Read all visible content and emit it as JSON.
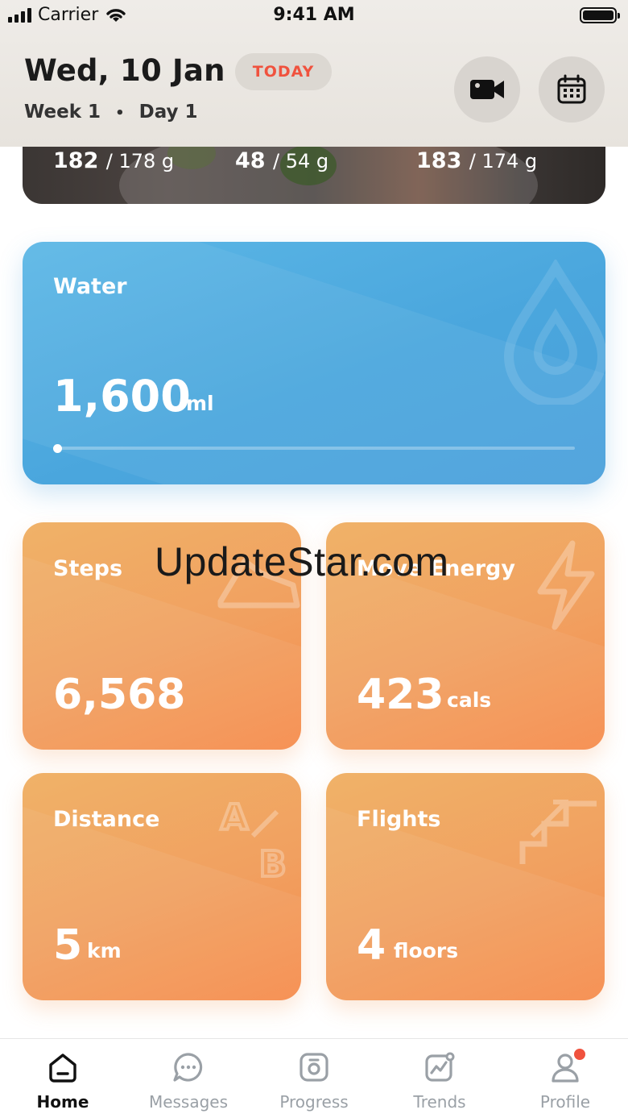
{
  "status_bar": {
    "carrier": "Carrier",
    "time": "9:41 AM"
  },
  "header": {
    "date": "Wed, 10 Jan",
    "badge": "TODAY",
    "week": "Week 1",
    "separator": "•",
    "day": "Day 1",
    "video_icon": "video-camera-icon",
    "calendar_icon": "calendar-icon"
  },
  "macros": [
    {
      "value": "182",
      "goal": "/ 178 g"
    },
    {
      "value": "48",
      "goal": "/ 54 g"
    },
    {
      "value": "183",
      "goal": "/ 174 g"
    }
  ],
  "water": {
    "label": "Water",
    "value": "1,600",
    "unit": "ml",
    "progress": 0.0
  },
  "tiles": {
    "steps": {
      "label": "Steps",
      "value": "6,568",
      "unit": ""
    },
    "move_energy": {
      "label": "Move Energy",
      "value": "423",
      "unit": "cals"
    },
    "distance": {
      "label": "Distance",
      "value": "5",
      "unit": "km"
    },
    "flights": {
      "label": "Flights",
      "value": "4",
      "unit": "floors"
    }
  },
  "watermark": "UpdateStar.com",
  "tabbar": {
    "items": [
      {
        "label": "Home",
        "icon": "home-icon",
        "active": true
      },
      {
        "label": "Messages",
        "icon": "chat-bubble-icon",
        "active": false
      },
      {
        "label": "Progress",
        "icon": "camera-icon",
        "active": false
      },
      {
        "label": "Trends",
        "icon": "trend-chart-icon",
        "active": false
      },
      {
        "label": "Profile",
        "icon": "profile-icon",
        "active": false
      }
    ]
  },
  "colors": {
    "accent": "#f0523e",
    "water": "#4aa6dd",
    "tile": "#f1a060"
  }
}
